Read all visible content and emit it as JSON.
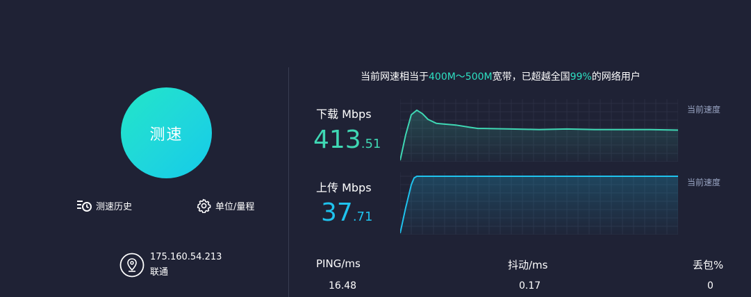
{
  "test_button": {
    "label": "测速"
  },
  "tools": {
    "history_label": "测速历史",
    "units_label": "单位/量程"
  },
  "connection": {
    "ip": "175.160.54.213",
    "isp": "联通"
  },
  "summary": {
    "prefix": "当前网速相当于",
    "bandwidth": "400M～500M",
    "middle": "宽带，已超越全国",
    "percent": "99%",
    "suffix": "的网络用户"
  },
  "download": {
    "label": "下载 Mbps",
    "value_int": "413",
    "value_dec": ".51",
    "chart_tag": "当前速度",
    "color": "#3fd8b4"
  },
  "upload": {
    "label": "上传 Mbps",
    "value_int": "37",
    "value_dec": ".71",
    "chart_tag": "当前速度",
    "color": "#1fc3ee"
  },
  "stats": {
    "ping_label": "PING/ms",
    "ping_value": "16.48",
    "jitter_label": "抖动/ms",
    "jitter_value": "0.17",
    "loss_label": "丢包%",
    "loss_value": "0"
  },
  "chart_data": [
    {
      "type": "line",
      "name": "download",
      "x": [
        0,
        2,
        4,
        6,
        8,
        10,
        13,
        15,
        20,
        25,
        28,
        30,
        40,
        50,
        60,
        70,
        80,
        90,
        100
      ],
      "y": [
        0,
        45,
        80,
        88,
        82,
        72,
        65,
        64,
        62,
        58,
        56,
        56,
        55,
        54,
        55,
        54,
        54,
        54,
        53
      ],
      "ylim": [
        0,
        100
      ],
      "grid": true
    },
    {
      "type": "line",
      "name": "upload",
      "x": [
        0,
        2,
        4,
        5,
        6,
        100
      ],
      "y": [
        0,
        45,
        85,
        97,
        100,
        100
      ],
      "ylim": [
        0,
        100
      ],
      "grid": true
    }
  ]
}
